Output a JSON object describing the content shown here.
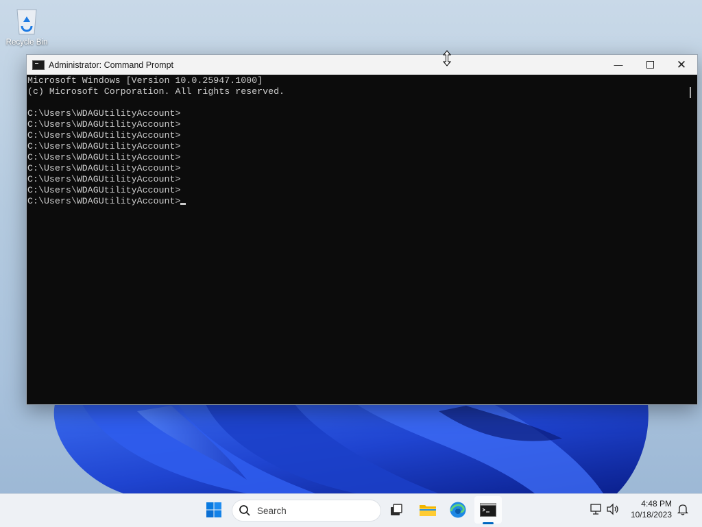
{
  "desktop": {
    "recycle_bin_label": "Recycle Bin"
  },
  "window": {
    "title": "Administrator: Command Prompt",
    "icon": "cmd-icon",
    "controls": [
      "minimize-icon",
      "maximize-icon",
      "close-icon"
    ]
  },
  "console": {
    "lines": [
      "Microsoft Windows [Version 10.0.25947.1000]",
      "(c) Microsoft Corporation. All rights reserved.",
      "",
      "C:\\Users\\WDAGUtilityAccount>",
      "C:\\Users\\WDAGUtilityAccount>",
      "C:\\Users\\WDAGUtilityAccount>",
      "C:\\Users\\WDAGUtilityAccount>",
      "C:\\Users\\WDAGUtilityAccount>",
      "C:\\Users\\WDAGUtilityAccount>",
      "C:\\Users\\WDAGUtilityAccount>",
      "C:\\Users\\WDAGUtilityAccount>"
    ],
    "prompt": "C:\\Users\\WDAGUtilityAccount>"
  },
  "taskbar": {
    "search_placeholder": "Search",
    "apps": [
      "start-icon",
      "task-view-icon",
      "file-explorer-icon",
      "edge-icon",
      "terminal-icon"
    ],
    "active_app": "terminal-icon",
    "time": "4:48 PM",
    "date": "10/18/2023"
  },
  "colors": {
    "console_bg": "#0c0c0c",
    "console_fg": "#cccccc",
    "accent": "#0067c0",
    "taskbar_bg": "#eef1f5"
  }
}
